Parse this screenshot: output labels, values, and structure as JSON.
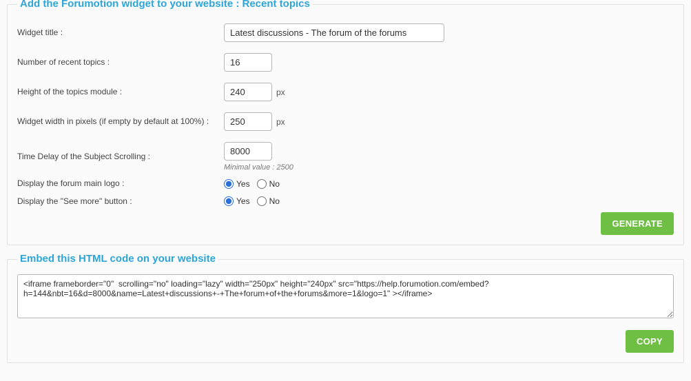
{
  "widget_panel": {
    "title": "Add the Forumotion widget to your website : Recent topics",
    "rows": {
      "title_label": "Widget title :",
      "title_value": "Latest discussions - The forum of the forums",
      "num_label": "Number of recent topics :",
      "num_value": "16",
      "height_label": "Height of the topics module :",
      "height_value": "240",
      "height_unit": "px",
      "width_label": "Widget width in pixels (if empty by default at 100%) :",
      "width_value": "250",
      "width_unit": "px",
      "delay_label": "Time Delay of the Subject Scrolling :",
      "delay_value": "8000",
      "delay_hint": "Minimal value : 2500",
      "logo_label": "Display the forum main logo :",
      "seemore_label": "Display the \"See more\" button :",
      "yes": "Yes",
      "no": "No"
    },
    "generate_btn": "GENERATE"
  },
  "embed_panel": {
    "title": "Embed this HTML code on your website",
    "code": "<iframe frameborder=\"0\"  scrolling=\"no\" loading=\"lazy\" width=\"250px\" height=\"240px\" src=\"https://help.forumotion.com/embed?h=144&nbt=16&d=8000&name=Latest+discussions+-+The+forum+of+the+forums&more=1&logo=1\" ></iframe>",
    "copy_btn": "COPY"
  }
}
